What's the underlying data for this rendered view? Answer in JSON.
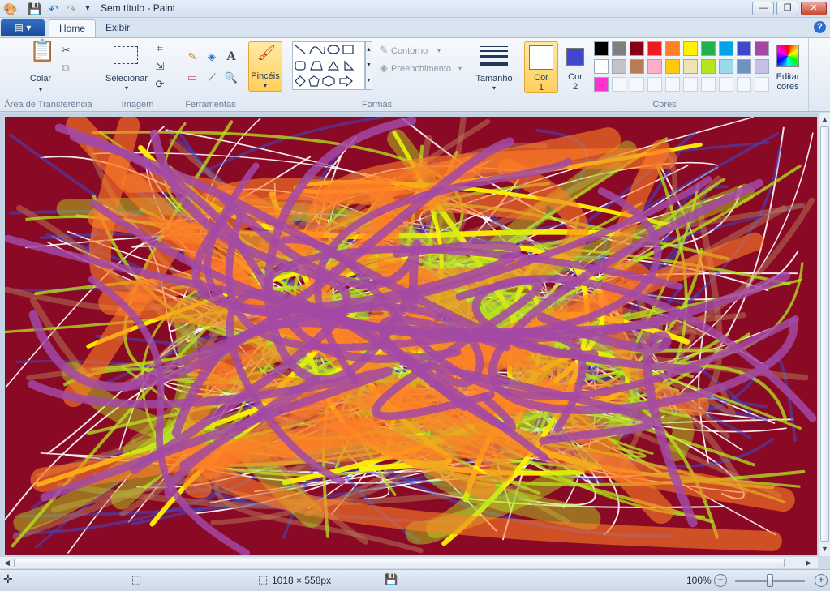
{
  "window": {
    "title": "Sem título - Paint",
    "minimize": "—",
    "maximize": "❐",
    "close": "✕"
  },
  "tabs": {
    "file": "▤ ▾",
    "home": "Home",
    "view": "Exibir"
  },
  "ribbon": {
    "clipboard": {
      "label": "Área de Transferência",
      "paste": "Colar"
    },
    "image": {
      "label": "Imagem",
      "select": "Selecionar"
    },
    "tools": {
      "label": "Ferramentas"
    },
    "brushes": {
      "label": "Pincéis"
    },
    "shapes": {
      "label": "Formas",
      "outline": "Contorno",
      "fill": "Preenchimento"
    },
    "size": {
      "label": "Tamanho"
    },
    "color1": {
      "line1": "Cor",
      "line2": "1",
      "color": "#ffffff"
    },
    "color2": {
      "line1": "Cor",
      "line2": "2",
      "color": "#3f48cc"
    },
    "colors": {
      "label": "Cores"
    },
    "edit_colors": {
      "line1": "Editar",
      "line2": "cores"
    },
    "palette": [
      "#000000",
      "#7f7f7f",
      "#880015",
      "#ed1c24",
      "#ff7f27",
      "#fff200",
      "#22b14c",
      "#00a2e8",
      "#3f48cc",
      "#a349a4",
      "#ffffff",
      "#c3c3c3",
      "#b97a57",
      "#ffaec9",
      "#ffc90e",
      "#efe4b0",
      "#b5e61d",
      "#99d9ea",
      "#7092be",
      "#c8bfe7",
      "#ff33cc",
      "",
      "",
      "",
      "",
      "",
      "",
      "",
      "",
      ""
    ]
  },
  "painting": {
    "background": "#8a0a25",
    "stroke_colors": [
      "#ffffff",
      "#a349a4",
      "#ff7f27",
      "#b5e61d",
      "#fff200",
      "#b97a57",
      "#3f48cc"
    ]
  },
  "status": {
    "dimensions": "1018 × 558px",
    "zoom": "100%"
  }
}
